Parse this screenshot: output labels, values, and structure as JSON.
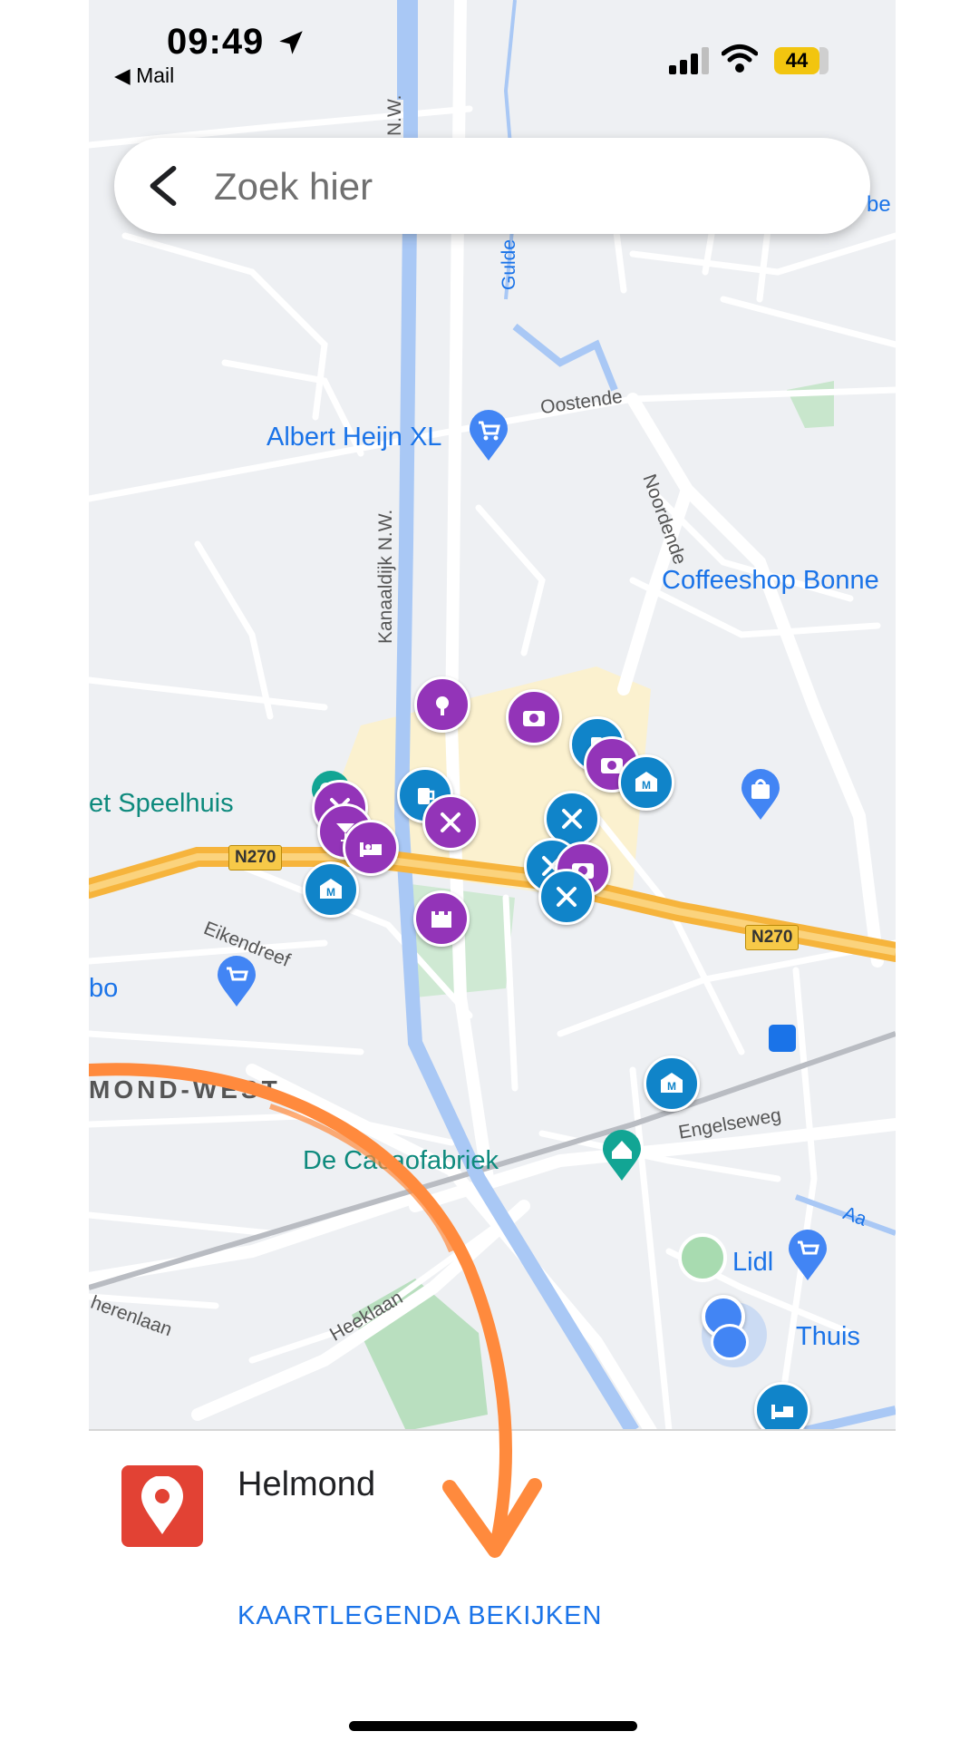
{
  "status_bar": {
    "time": "09:49",
    "back_app": "◀ Mail",
    "battery": "44"
  },
  "search": {
    "placeholder": "Zoek hier"
  },
  "map": {
    "place_labels": {
      "albert_heijn": "Albert Heijn XL",
      "coffeeshop": "Coffeeshop Bonne",
      "speelhuis": "et Speelhuis",
      "cacaofabriek": "De Cacaofabriek",
      "lidl": "Lidl",
      "thuis": "Thuis",
      "jumbo": "bo"
    },
    "road_labels": {
      "oostende": "Oostende",
      "noordende": "Noordende",
      "kanaaldijk": "Kanaaldijk N.W.",
      "kanaaldijk_top": "N.W.",
      "gulde": "Gulde",
      "eikendreef": "Eikendreef",
      "engelseweg": "Engelseweg",
      "heeklaan": "Heeklaan",
      "herenlaan": "herenlaan",
      "aa": "Aa",
      "be": "be"
    },
    "area_label": "MOND-WEST",
    "route_shields": [
      "N270",
      "N270"
    ]
  },
  "bottom_sheet": {
    "place_name": "Helmond",
    "legend_link": "KAARTLEGENDA BEKIJKEN"
  },
  "colors": {
    "map_bg": "#eef0f3",
    "highway": "#f6b43c",
    "canal": "#a9c8f5",
    "accent": "#1a73e8",
    "annotation_arrow": "#ff8a3d",
    "place_red": "#e24234"
  }
}
